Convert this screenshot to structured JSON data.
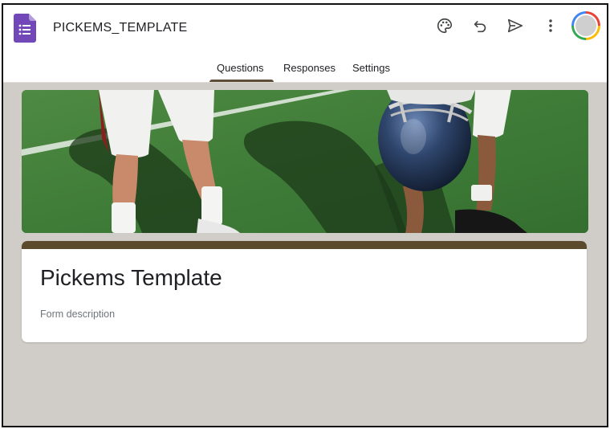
{
  "app": {
    "title": "PICKEMS_TEMPLATE",
    "logo_icon": "google-forms-icon"
  },
  "toolbar": {
    "icons": [
      "palette-icon",
      "undo-icon",
      "send-icon",
      "more-vert-icon"
    ],
    "avatar": "account-avatar"
  },
  "tabs": [
    {
      "label": "Questions",
      "active": true
    },
    {
      "label": "Responses",
      "active": false
    },
    {
      "label": "Settings",
      "active": false
    }
  ],
  "header_image": {
    "subject": "football-players-on-field"
  },
  "form": {
    "title": "Pickems Template",
    "description_placeholder": "Form description"
  },
  "colors": {
    "theme_accent": "#5c4a2d",
    "page_background": "#d0cdc8",
    "forms_purple": "#7248b9"
  }
}
